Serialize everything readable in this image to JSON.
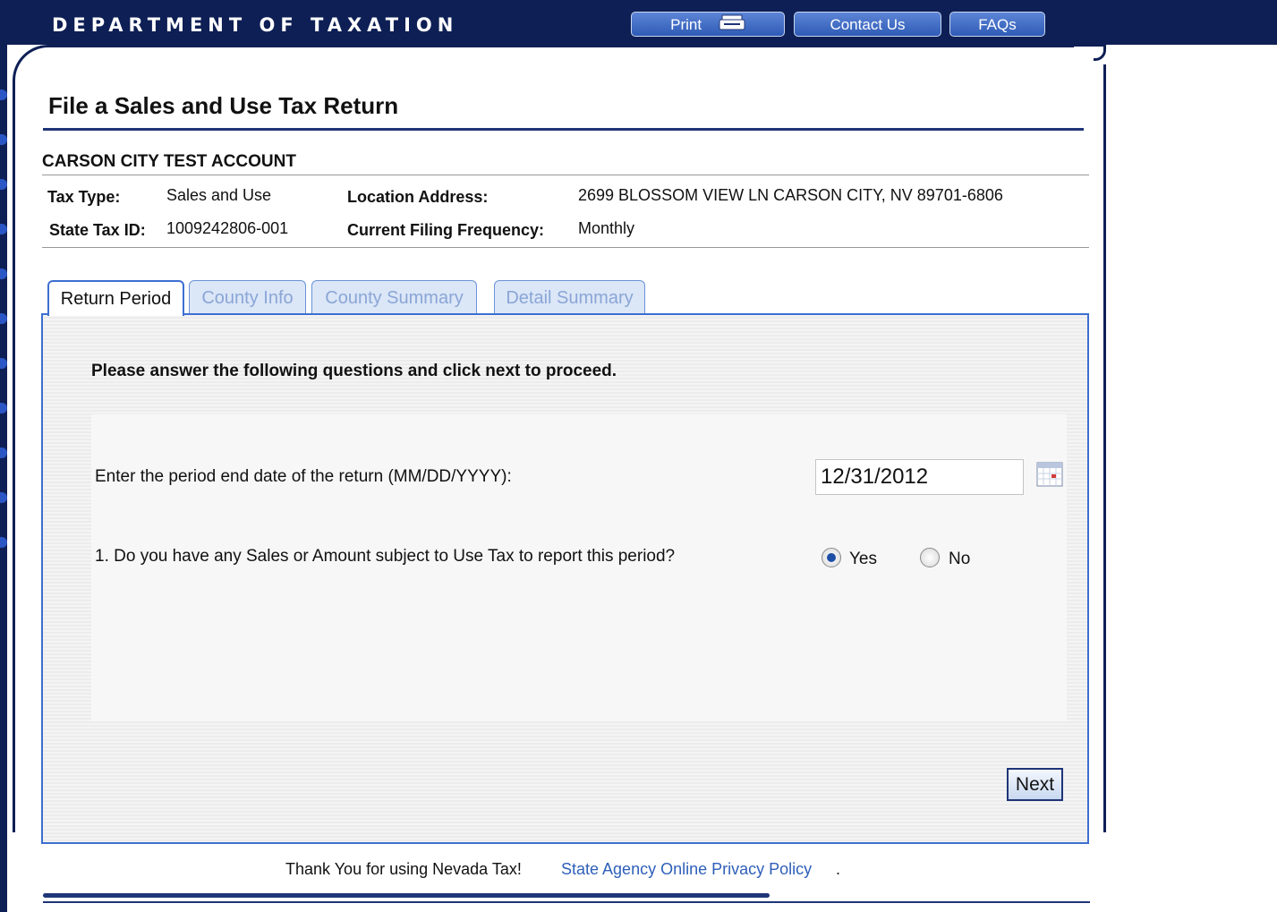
{
  "header": {
    "title": "DEPARTMENT OF TAXATION",
    "buttons": {
      "print": "Print",
      "contact": "Contact Us",
      "faqs": "FAQs"
    }
  },
  "page": {
    "title": "File a Sales and Use Tax Return"
  },
  "account": {
    "name": "CARSON CITY TEST ACCOUNT",
    "tax_type_label": "Tax Type:",
    "tax_type_value": "Sales and Use",
    "state_tax_id_label": "State Tax ID:",
    "state_tax_id_value": "1009242806-001",
    "location_label": "Location Address:",
    "location_value": "2699 BLOSSOM VIEW LN CARSON CITY, NV 89701-6806",
    "frequency_label": "Current Filing Frequency:",
    "frequency_value": "Monthly"
  },
  "tabs": [
    {
      "label": "Return Period",
      "active": true
    },
    {
      "label": "County Info",
      "active": false
    },
    {
      "label": "County Summary",
      "active": false
    },
    {
      "label": "Detail Summary",
      "active": false
    }
  ],
  "form": {
    "instruction": "Please answer the following questions and click next to proceed.",
    "date_question": "Enter the period end date of the return (MM/DD/YYYY):",
    "date_value": "12/31/2012",
    "q1": "1. Do you have any Sales or Amount subject to Use Tax to report this period?",
    "yes_label": "Yes",
    "no_label": "No",
    "selected": "Yes",
    "next_label": "Next"
  },
  "footer": {
    "thanks": "Thank You for using Nevada Tax!",
    "privacy_link": "State Agency Online Privacy Policy",
    "period": "."
  },
  "icons": {
    "print": "printer-icon",
    "calendar": "calendar-icon"
  },
  "colors": {
    "header_bg": "#0e1f55",
    "accent": "#3d6fd0",
    "link": "#2e5fb9"
  }
}
